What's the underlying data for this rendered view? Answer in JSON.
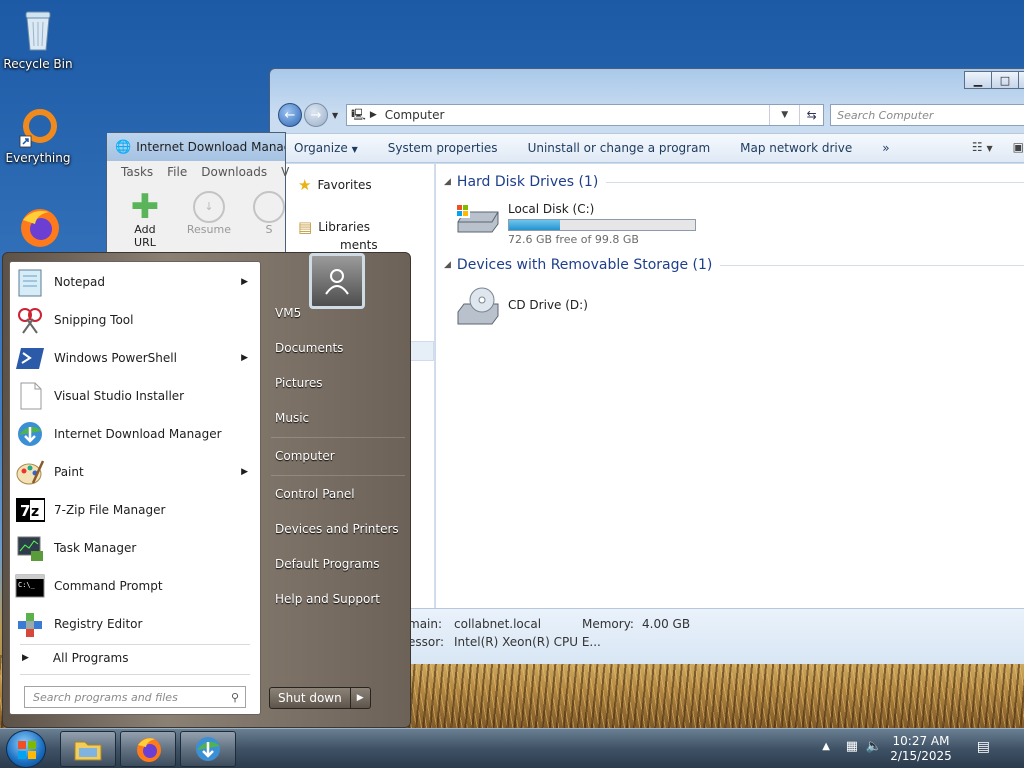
{
  "desktop": {
    "icons": [
      {
        "label": "Recycle Bin",
        "icon": "recycle-bin-icon"
      },
      {
        "label": "Everything",
        "icon": "everything-icon"
      },
      {
        "label": "",
        "icon": "firefox-icon"
      }
    ]
  },
  "explorer": {
    "address": "Computer",
    "search_placeholder": "Search Computer",
    "toolbar": {
      "organize": "Organize",
      "system_properties": "System properties",
      "uninstall": "Uninstall or change a program",
      "map_drive": "Map network drive",
      "more": "»"
    },
    "nav": {
      "favorites": "Favorites",
      "libraries": "Libraries",
      "documents_partial": "ments"
    },
    "groups": {
      "hdd": "Hard Disk Drives (1)",
      "removable": "Devices with Removable Storage (1)"
    },
    "drives": {
      "c_name": "Local Disk (C:)",
      "c_free": "72.6 GB free of 99.8 GB",
      "c_used_fraction": 0.273,
      "d_name": "CD Drive (D:)"
    },
    "details": {
      "domain_label": "main:",
      "domain_value": "collabnet.local",
      "memory_label": "Memory:",
      "memory_value": "4.00 GB",
      "processor_label": "essor:",
      "processor_value": "Intel(R) Xeon(R) CPU E..."
    }
  },
  "idm": {
    "title": "Internet Download Manag",
    "menu": [
      "Tasks",
      "File",
      "Downloads",
      "V"
    ],
    "tools": {
      "add_url": "Add URL",
      "resume": "Resume",
      "partial": "S"
    }
  },
  "start_menu": {
    "programs": [
      {
        "label": "Notepad",
        "icon": "notepad-icon",
        "arrow": "▶"
      },
      {
        "label": "Snipping Tool",
        "icon": "snipping-tool-icon",
        "arrow": ""
      },
      {
        "label": "Windows PowerShell",
        "icon": "powershell-icon",
        "arrow": "▶"
      },
      {
        "label": "Visual Studio Installer",
        "icon": "document-icon",
        "arrow": ""
      },
      {
        "label": "Internet Download Manager",
        "icon": "idm-icon",
        "arrow": ""
      },
      {
        "label": "Paint",
        "icon": "paint-icon",
        "arrow": "▶"
      },
      {
        "label": "7-Zip File Manager",
        "icon": "7zip-icon",
        "arrow": ""
      },
      {
        "label": "Task Manager",
        "icon": "task-manager-icon",
        "arrow": ""
      },
      {
        "label": "Command Prompt",
        "icon": "command-prompt-icon",
        "arrow": ""
      },
      {
        "label": "Registry Editor",
        "icon": "registry-editor-icon",
        "arrow": ""
      }
    ],
    "all_programs": "All Programs",
    "search_placeholder": "Search programs and files",
    "right": {
      "user": "VM5",
      "documents": "Documents",
      "pictures": "Pictures",
      "music": "Music",
      "computer": "Computer",
      "control_panel": "Control Panel",
      "devices": "Devices and Printers",
      "default_programs": "Default Programs",
      "help": "Help and Support"
    },
    "shutdown": "Shut down"
  },
  "taskbar": {
    "time": "10:27 AM",
    "date": "2/15/2025"
  }
}
